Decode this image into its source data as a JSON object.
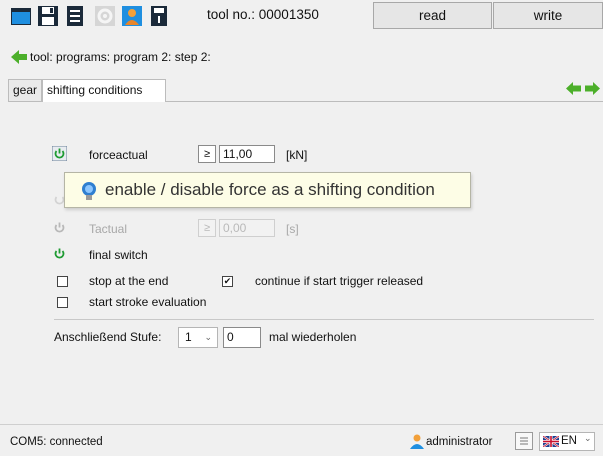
{
  "toolbar": {
    "icons": [
      "folder-icon",
      "save-icon",
      "print-icon",
      "settings-icon",
      "user-up-icon",
      "device-info-icon"
    ],
    "tool_label": "tool no.: 00001350",
    "read_label": "read",
    "write_label": "write"
  },
  "breadcrumb": {
    "text": "tool: programs: program 2: step 2:"
  },
  "tabs": [
    {
      "label": "gear",
      "active": false
    },
    {
      "label": "shifting conditions",
      "active": true
    }
  ],
  "conditions": {
    "force": {
      "label": "forceactual",
      "operator": "≥",
      "value": "11,00",
      "unit": "[kN]",
      "enabled": true
    },
    "time": {
      "label": "Tactual",
      "operator": "≥",
      "value": "0,00",
      "unit": "[s]",
      "enabled": false
    },
    "final_switch": {
      "label": "final switch",
      "enabled": true
    }
  },
  "tooltip": {
    "text": "enable / disable force as a shifting condition"
  },
  "options": {
    "stop_at_end": {
      "label": "stop at the end",
      "checked": false
    },
    "continue_trigger": {
      "label": "continue if start trigger released",
      "checked": true
    },
    "stroke_eval": {
      "label": "start stroke evaluation",
      "checked": false
    }
  },
  "repeat": {
    "prefix": "Anschließend Stufe:",
    "stage_value": "1",
    "count_value": "0",
    "suffix": "mal wiederholen"
  },
  "status": {
    "connection": "COM5: connected",
    "user": "administrator",
    "language": "EN"
  },
  "colors": {
    "power_on": "#1e9b32",
    "power_off": "#b8b8b8",
    "arrow_green": "#4caf2a",
    "tooltip_bg": "#fdfde6"
  }
}
